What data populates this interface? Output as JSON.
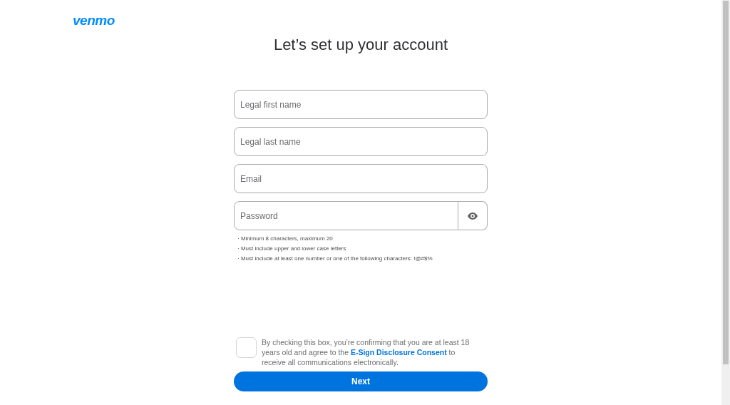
{
  "logo": "venmo",
  "heading": "Let’s set up your account",
  "fields": [
    {
      "placeholder": "Legal first name",
      "kind": "text"
    },
    {
      "placeholder": "Legal last name",
      "kind": "text"
    },
    {
      "placeholder": "Email",
      "kind": "text"
    },
    {
      "placeholder": "Password",
      "kind": "password"
    }
  ],
  "password_rules": [
    "· Minimum 8 characters, maximum 20",
    "· Must include upper and lower case letters",
    "· Must include at least one number or one of the following characters: !@#$%"
  ],
  "consent": {
    "checked": false,
    "text_before": "By checking this box, you’re confirming that you are at least 18 years old and agree to the",
    "link": "E-Sign Disclosure Consent",
    "text_after": "to receive all communications electronically."
  },
  "next_button": "Next"
}
